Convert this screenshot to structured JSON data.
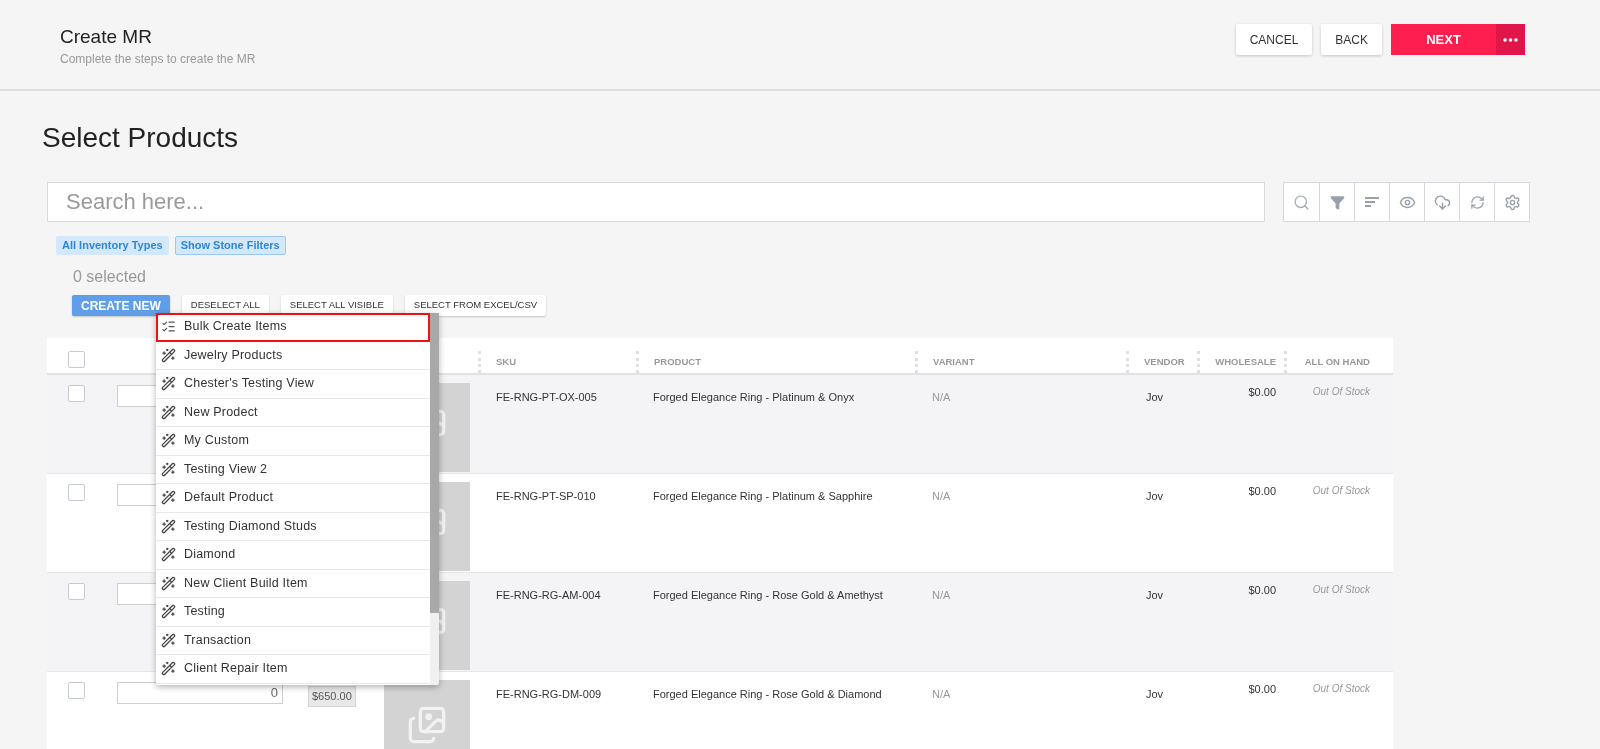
{
  "header": {
    "title": "Create MR",
    "subtitle": "Complete the steps to create the MR",
    "buttons": [
      {
        "label": "CANCEL",
        "kind": "plain"
      },
      {
        "label": "BACK",
        "kind": "plain"
      },
      {
        "label": "NEXT",
        "kind": "primary"
      }
    ]
  },
  "page_title": "Select Products",
  "search": {
    "placeholder": "Search here..."
  },
  "chips": [
    {
      "label": "All Inventory Types",
      "selected": false
    },
    {
      "label": "Show Stone Filters",
      "selected": true
    }
  ],
  "selection_count": "0 selected",
  "actions": [
    {
      "label": "CREATE NEW",
      "kind": "primary"
    },
    {
      "label": "DESELECT ALL",
      "kind": "plain"
    },
    {
      "label": "SELECT ALL VISIBLE",
      "kind": "plain"
    },
    {
      "label": "SELECT FROM EXCEL/CSV",
      "kind": "plain"
    }
  ],
  "menu": [
    {
      "label": "Bulk Create Items",
      "kind": "bulk",
      "highlighted": true
    },
    {
      "label": "Jewelry Products",
      "kind": "view",
      "highlighted": false
    },
    {
      "label": "Chester's Testing View",
      "kind": "view",
      "highlighted": false
    },
    {
      "label": "New Prodect",
      "kind": "view",
      "highlighted": false
    },
    {
      "label": "My Custom",
      "kind": "view",
      "highlighted": false
    },
    {
      "label": "Testing View 2",
      "kind": "view",
      "highlighted": false
    },
    {
      "label": "Default Product",
      "kind": "view",
      "highlighted": false
    },
    {
      "label": "Testing Diamond Studs",
      "kind": "view",
      "highlighted": false
    },
    {
      "label": "Diamond",
      "kind": "view",
      "highlighted": false
    },
    {
      "label": "New Client Build Item",
      "kind": "view",
      "highlighted": false
    },
    {
      "label": "Testing",
      "kind": "view",
      "highlighted": false
    },
    {
      "label": "Transaction",
      "kind": "view",
      "highlighted": false
    },
    {
      "label": "Client Repair Item",
      "kind": "view",
      "highlighted": false
    }
  ],
  "table": {
    "header_checked": false,
    "columns": [
      "SKU",
      "PRODUCT",
      "VARIANT",
      "VENDOR",
      "WHOLESALE",
      "ALL ON HAND"
    ],
    "rows": [
      {
        "checked": false,
        "sku": "FE-RNG-PT-OX-005",
        "product": "Forged Elegance Ring - Platinum & Onyx",
        "variant": "N/A",
        "vendor": "Jov",
        "wholesale": "$0.00",
        "on_hand": "Out Of Stock"
      },
      {
        "checked": false,
        "sku": "FE-RNG-PT-SP-010",
        "product": "Forged Elegance Ring - Platinum & Sapphire",
        "variant": "N/A",
        "vendor": "Jov",
        "wholesale": "$0.00",
        "on_hand": "Out Of Stock"
      },
      {
        "checked": false,
        "sku": "FE-RNG-RG-AM-004",
        "product": "Forged Elegance Ring - Rose Gold & Amethyst",
        "variant": "N/A",
        "vendor": "Jov",
        "wholesale": "$0.00",
        "on_hand": "Out Of Stock"
      },
      {
        "checked": false,
        "qty": "0",
        "unit_cost": "$650.00",
        "sku": "FE-RNG-RG-DM-009",
        "product": "Forged Elegance Ring - Rose Gold & Diamond",
        "variant": "N/A",
        "vendor": "Jov",
        "wholesale": "$0.00",
        "on_hand": "Out Of Stock"
      }
    ]
  }
}
